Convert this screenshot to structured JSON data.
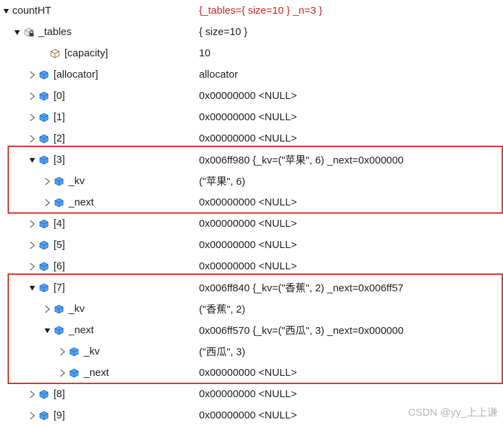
{
  "root": {
    "name": "countHT",
    "value": "{_tables={ size=10 } _n=3 }"
  },
  "tables": {
    "name": "_tables",
    "value": "{ size=10 }"
  },
  "capacity": {
    "name": "[capacity]",
    "value": "10"
  },
  "allocator": {
    "name": "[allocator]",
    "value": "allocator"
  },
  "slot0": {
    "name": "[0]",
    "value": "0x00000000 <NULL>"
  },
  "slot1": {
    "name": "[1]",
    "value": "0x00000000 <NULL>"
  },
  "slot2": {
    "name": "[2]",
    "value": "0x00000000 <NULL>"
  },
  "slot3": {
    "name": "[3]",
    "value": "0x006ff980 {_kv=(\"苹果\", 6) _next=0x000000"
  },
  "slot3_kv": {
    "name": "_kv",
    "value": "(\"苹果\", 6)"
  },
  "slot3_next": {
    "name": "_next",
    "value": "0x00000000 <NULL>"
  },
  "slot4": {
    "name": "[4]",
    "value": "0x00000000 <NULL>"
  },
  "slot5": {
    "name": "[5]",
    "value": "0x00000000 <NULL>"
  },
  "slot6": {
    "name": "[6]",
    "value": "0x00000000 <NULL>"
  },
  "slot7": {
    "name": "[7]",
    "value": "0x006ff840 {_kv=(\"香蕉\", 2) _next=0x006ff57"
  },
  "slot7_kv": {
    "name": "_kv",
    "value": "(\"香蕉\", 2)"
  },
  "slot7_next": {
    "name": "_next",
    "value": "0x006ff570 {_kv=(\"西瓜\", 3) _next=0x000000"
  },
  "slot7_next_kv": {
    "name": "_kv",
    "value": "(\"西瓜\", 3)"
  },
  "slot7_next_next": {
    "name": "_next",
    "value": "0x00000000 <NULL>"
  },
  "slot8": {
    "name": "[8]",
    "value": "0x00000000 <NULL>"
  },
  "slot9": {
    "name": "[9]",
    "value": "0x00000000 <NULL>"
  },
  "watermark": "CSDN @yy_上上谦"
}
